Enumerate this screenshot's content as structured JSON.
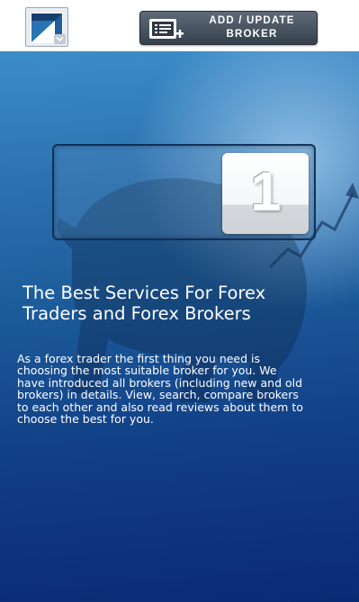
{
  "header": {
    "menu_icon": "logo-icon",
    "add_update_broker": {
      "line1": "ADD / UPDATE",
      "line2": "BROKER",
      "icon": "list-add-icon"
    }
  },
  "hero": {
    "counter_value": "1",
    "headline": [
      "The Best Services For Forex",
      "Traders and Forex Brokers"
    ],
    "description": [
      "As a forex trader the first thing you need is",
      "choosing the most suitable broker for you. We",
      "have introduced all brokers (including new and old",
      "brokers) in details. View, search, compare brokers",
      "to each other and also read reviews about them to",
      "choose the best for you."
    ],
    "background_image": "bear-bull-market-icon"
  },
  "colors": {
    "button_dark": "#36404d",
    "hero_top": "#3d8dc9",
    "hero_bottom": "#0a2a74",
    "logo_blue": "#1f5f9c"
  }
}
